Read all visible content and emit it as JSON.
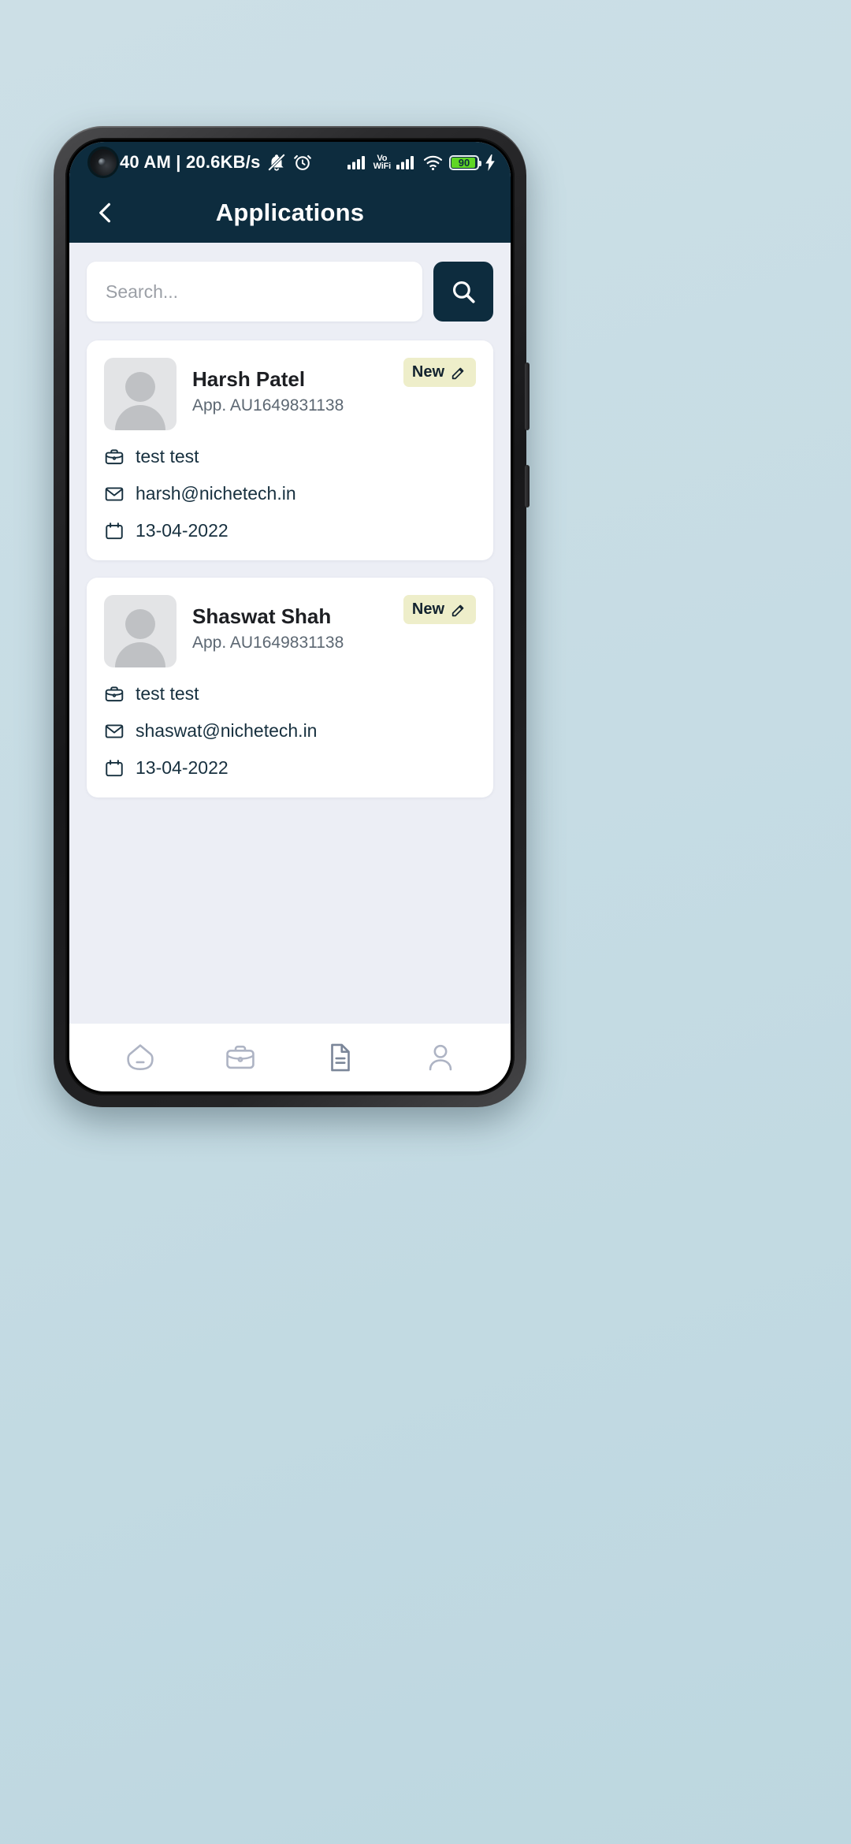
{
  "statusbar": {
    "text": "40 AM | 20.6KB/s",
    "bell_icon": "bell-muted-icon",
    "alarm_icon": "alarm-clock-icon",
    "signal_icon": "signal-bars-icon",
    "network_label": "Vo\nWiFi",
    "network_line1": "Vo",
    "network_line2": "WiFi",
    "wifi_icon": "wifi-icon",
    "battery_level": "90",
    "charging_icon": "charging-bolt-icon",
    "battery_color": "#5fd624"
  },
  "header": {
    "title": "Applications",
    "back_icon": "chevron-left-icon",
    "background_color": "#0d2c3e"
  },
  "search": {
    "placeholder": "Search...",
    "value": "",
    "button_icon": "search-icon",
    "button_color": "#0d2c3e"
  },
  "cards": [
    {
      "name": "Harsh Patel",
      "application": "App. AU1649831138",
      "badge_label": "New",
      "badge_icon": "edit-pencil-icon",
      "badge_color": "#eeeeca",
      "avatar_icon": "person-placeholder-icon",
      "details": [
        {
          "icon": "briefcase-icon",
          "text": "test test"
        },
        {
          "icon": "envelope-icon",
          "text": "harsh@nichetech.in"
        },
        {
          "icon": "calendar-icon",
          "text": "13-04-2022"
        }
      ]
    },
    {
      "name": "Shaswat Shah",
      "application": "App. AU1649831138",
      "badge_label": "New",
      "badge_icon": "edit-pencil-icon",
      "badge_color": "#eeeeca",
      "avatar_icon": "person-placeholder-icon",
      "details": [
        {
          "icon": "briefcase-icon",
          "text": "test test"
        },
        {
          "icon": "envelope-icon",
          "text": "shaswat@nichetech.in"
        },
        {
          "icon": "calendar-icon",
          "text": "13-04-2022"
        }
      ]
    }
  ],
  "bottom_nav": [
    {
      "icon": "home-icon",
      "name": "home"
    },
    {
      "icon": "briefcase-icon",
      "name": "jobs"
    },
    {
      "icon": "document-icon",
      "name": "applications"
    },
    {
      "icon": "person-icon",
      "name": "profile"
    }
  ]
}
